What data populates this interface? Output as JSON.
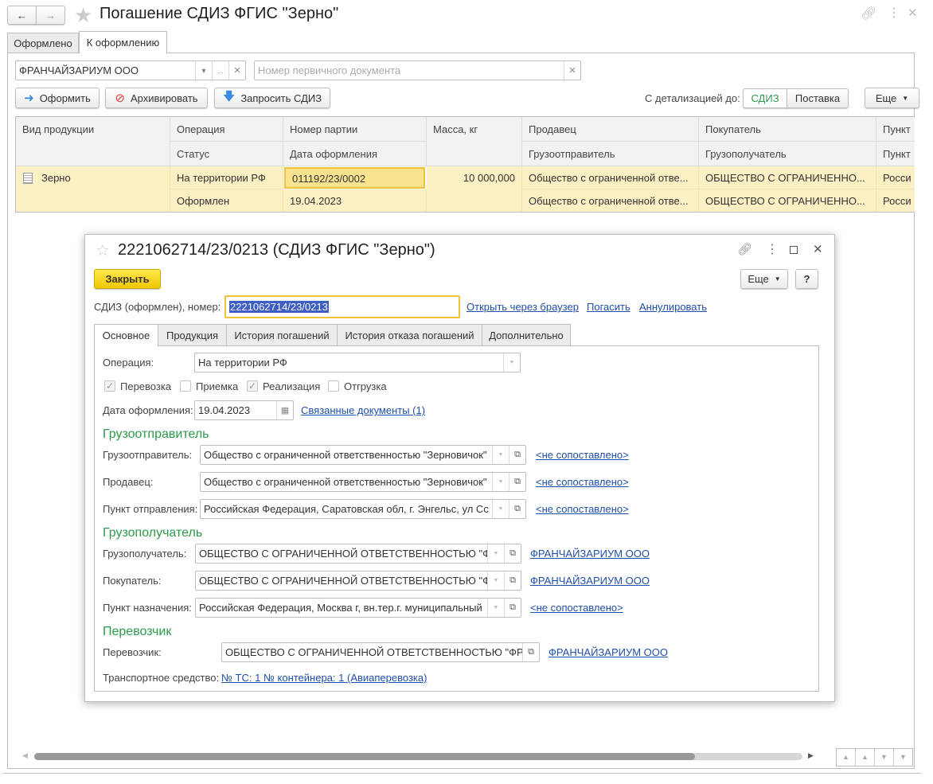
{
  "window": {
    "title": "Погашение СДИЗ ФГИС \"Зерно\""
  },
  "tabs": [
    {
      "label": "Оформлено"
    },
    {
      "label": "К оформлению",
      "active": true
    }
  ],
  "filters": {
    "organization": "ФРАНЧАЙЗАРИУМ ООО",
    "doc_number_placeholder": "Номер первичного документа"
  },
  "toolbar": {
    "issue": "Оформить",
    "archive": "Архивировать",
    "request": "Запросить СДИЗ",
    "detail_label": "С детализацией до:",
    "detail_options": [
      "СДИЗ",
      "Поставка"
    ],
    "detail_selected": "СДИЗ",
    "more": "Еще"
  },
  "table": {
    "headers": {
      "product": "Вид продукции",
      "operation": "Операция",
      "status": "Статус",
      "batch": "Номер партии",
      "date": "Дата оформления",
      "mass": "Масса, кг",
      "seller": "Продавец",
      "shipper": "Грузоотправитель",
      "buyer": "Покупатель",
      "consignee": "Грузополучатель",
      "point1": "Пункт",
      "point2": "Пункт"
    },
    "rows": [
      {
        "product": "Зерно",
        "operation": "На территории РФ",
        "status": "Оформлен",
        "batch": "011192/23/0002",
        "date": "19.04.2023",
        "mass": "10 000,000",
        "seller": "Общество с ограниченной отве...",
        "shipper": "Общество с ограниченной отве...",
        "buyer": "ОБЩЕСТВО С ОГРАНИЧЕННО...",
        "consignee": "ОБЩЕСТВО С ОГРАНИЧЕННО...",
        "point1": "Росси",
        "point2": "Росси"
      }
    ]
  },
  "dialog": {
    "title": "2221062714/23/0213 (СДИЗ ФГИС \"Зерно\")",
    "close": "Закрыть",
    "more": "Еще",
    "help": "?",
    "number_label": "СДИЗ (оформлен), номер:",
    "number": "2221062714/23/0213",
    "links": {
      "browser": "Открыть через браузер",
      "repay": "Погасить",
      "cancel": "Аннулировать"
    },
    "tabs": [
      "Основное",
      "Продукция",
      "История погашений",
      "История отказа погашений",
      "Дополнительно"
    ],
    "operation_label": "Операция:",
    "operation": "На территории РФ",
    "checks": [
      {
        "label": "Перевозка",
        "checked": true
      },
      {
        "label": "Приемка",
        "checked": false
      },
      {
        "label": "Реализация",
        "checked": true
      },
      {
        "label": "Отгрузка",
        "checked": false
      }
    ],
    "date_label": "Дата оформления:",
    "date": "19.04.2023",
    "related": "Связанные документы (1)",
    "sec_shipper": "Грузоотправитель",
    "shipper": [
      {
        "label": "Грузоотправитель:",
        "value": "Общество с ограниченной ответственностью \"Зерновичок\"",
        "link": "<не сопоставлено>"
      },
      {
        "label": "Продавец:",
        "value": "Общество с ограниченной ответственностью \"Зерновичок\"",
        "link": "<не сопоставлено>"
      },
      {
        "label": "Пункт отправления:",
        "value": "Российская Федерация, Саратовская обл, г. Энгельс, ул Сс",
        "link": "<не сопоставлено>"
      }
    ],
    "sec_consignee": "Грузополучатель",
    "consignee": [
      {
        "label": "Грузополучатель:",
        "value": "ОБЩЕСТВО С ОГРАНИЧЕННОЙ ОТВЕТСТВЕННОСТЬЮ \"Ф",
        "link": "ФРАНЧАЙЗАРИУМ ООО"
      },
      {
        "label": "Покупатель:",
        "value": "ОБЩЕСТВО С ОГРАНИЧЕННОЙ ОТВЕТСТВЕННОСТЬЮ \"Ф",
        "link": "ФРАНЧАЙЗАРИУМ ООО"
      },
      {
        "label": "Пункт назначения:",
        "value": "Российская Федерация, Москва г, вн.тер.г. муниципальный",
        "link": "<не сопоставлено>"
      }
    ],
    "sec_carrier": "Перевозчик",
    "carrier": {
      "label": "Перевозчик:",
      "value": "ОБЩЕСТВО С ОГРАНИЧЕННОЙ ОТВЕТСТВЕННОСТЬЮ \"ФР",
      "link": "ФРАНЧАЙЗАРИУМ ООО"
    },
    "vehicle_label": "Транспортное средство:",
    "vehicle": "№ ТС: 1 № контейнера: 1 (Авиаперевозка)"
  },
  "scroll": {
    "horizontal_position_percent": 86
  },
  "colors": {
    "accent_yellow": "#f5d000",
    "row_highlight": "#fbf0c4",
    "section_green": "#2d9a4b",
    "link": "#1f4ea8",
    "selection": "#3d5fc4"
  }
}
